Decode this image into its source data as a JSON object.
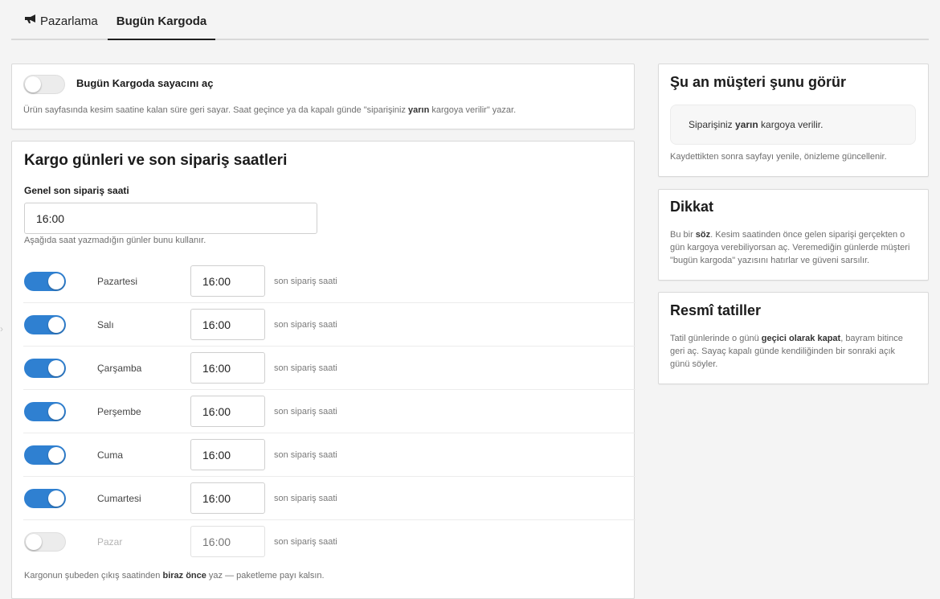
{
  "tabs": [
    {
      "label": "Pazarlama",
      "icon": "megaphone-icon",
      "active": false
    },
    {
      "label": "Bugün Kargoda",
      "active": true
    }
  ],
  "counter_card": {
    "toggle_label": "Bugün Kargoda sayacını aç",
    "toggle_on": false,
    "desc_pre": "Ürün sayfasında kesim saatine kalan süre geri sayar. Saat geçince ya da kapalı günde \"siparişiniz ",
    "desc_bold": "yarın",
    "desc_post": " kargoya verilir\" yazar."
  },
  "schedule_card": {
    "title": "Kargo günleri ve son sipariş saatleri",
    "general_label": "Genel son sipariş saati",
    "general_value": "16:00",
    "general_hint": "Aşağıda saat yazmadığın günler bunu kullanır.",
    "suffix": "son sipariş saati",
    "days": [
      {
        "name": "Pazartesi",
        "enabled": true,
        "time": "16:00"
      },
      {
        "name": "Salı",
        "enabled": true,
        "time": "16:00"
      },
      {
        "name": "Çarşamba",
        "enabled": true,
        "time": "16:00"
      },
      {
        "name": "Perşembe",
        "enabled": true,
        "time": "16:00"
      },
      {
        "name": "Cuma",
        "enabled": true,
        "time": "16:00"
      },
      {
        "name": "Cumartesi",
        "enabled": true,
        "time": "16:00"
      },
      {
        "name": "Pazar",
        "enabled": false,
        "time": "",
        "placeholder": "16:00"
      }
    ],
    "footer_pre": "Kargonun şubeden çıkış saatinden ",
    "footer_bold": "biraz önce",
    "footer_post": " yaz — paketleme payı kalsın."
  },
  "preview_card": {
    "title": "Şu an müşteri şunu görür",
    "preview_pre": "Siparişiniz ",
    "preview_bold": "yarın",
    "preview_post": " kargoya verilir.",
    "hint": "Kaydettikten sonra sayfayı yenile, önizleme güncellenir."
  },
  "warning_card": {
    "title": "Dikkat",
    "text_pre": "Bu bir ",
    "text_bold": "söz",
    "text_post": ". Kesim saatinden önce gelen siparişi gerçekten o gün kargoya verebiliyorsan aç. Veremediğin günlerde müşteri \"bugün kargoda\" yazısını hatırlar ve güveni sarsılır."
  },
  "holiday_card": {
    "title": "Resmî tatiller",
    "text_pre": "Tatil günlerinde o günü ",
    "text_bold": "geçici olarak kapat",
    "text_post": ", bayram bitince geri aç. Sayaç kapalı günde kendiliğinden bir sonraki açık günü söyler."
  },
  "colors": {
    "accent": "#2f80d1",
    "toggle_off": "#ececec"
  }
}
